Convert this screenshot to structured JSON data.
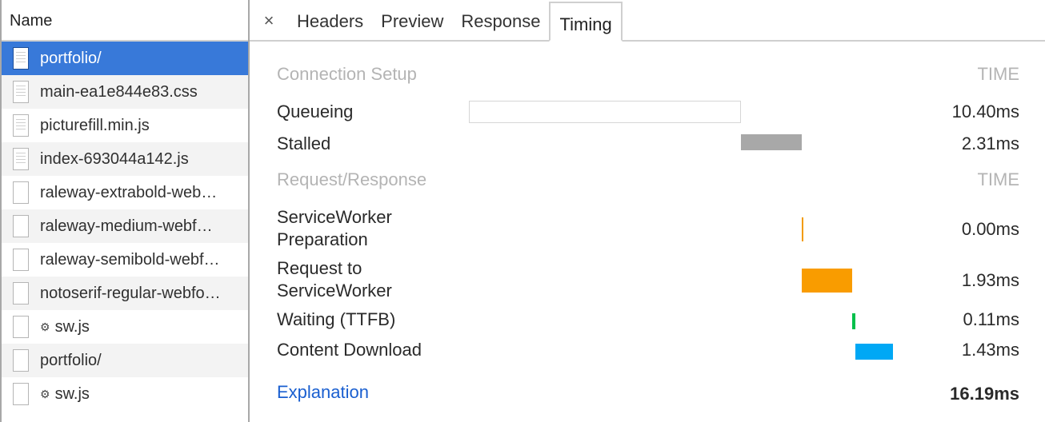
{
  "requests": {
    "header": "Name",
    "items": [
      {
        "name": "portfolio/",
        "icon": "document-icon",
        "gear": false,
        "selected": true
      },
      {
        "name": "main-ea1e844e83.css",
        "icon": "document-icon",
        "gear": false
      },
      {
        "name": "picturefill.min.js",
        "icon": "document-icon",
        "gear": false
      },
      {
        "name": "index-693044a142.js",
        "icon": "document-icon",
        "gear": false
      },
      {
        "name": "raleway-extrabold-web…",
        "icon": "blank-file-icon",
        "gear": false
      },
      {
        "name": "raleway-medium-webf…",
        "icon": "blank-file-icon",
        "gear": false
      },
      {
        "name": "raleway-semibold-webf…",
        "icon": "blank-file-icon",
        "gear": false
      },
      {
        "name": "notoserif-regular-webfo…",
        "icon": "blank-file-icon",
        "gear": false
      },
      {
        "name": "sw.js",
        "icon": "blank-file-icon",
        "gear": true
      },
      {
        "name": "portfolio/",
        "icon": "blank-file-icon",
        "gear": false
      },
      {
        "name": "sw.js",
        "icon": "blank-file-icon",
        "gear": true
      }
    ]
  },
  "tabs": {
    "close_glyph": "×",
    "items": [
      "Headers",
      "Preview",
      "Response",
      "Timing"
    ],
    "active": "Timing"
  },
  "timing": {
    "connection_setup": {
      "title": "Connection Setup",
      "time_label": "TIME",
      "rows": [
        {
          "label": "Queueing",
          "value": "10.40ms",
          "ms": 10.4,
          "color": "#ffffff",
          "outline": true
        },
        {
          "label": "Stalled",
          "value": "2.31ms",
          "ms": 2.31,
          "color": "#a8a8a8"
        }
      ]
    },
    "request_response": {
      "title": "Request/Response",
      "time_label": "TIME",
      "rows": [
        {
          "label": "ServiceWorker\nPreparation",
          "value": "0.00ms",
          "ms": 0.0,
          "color": "#f29b00"
        },
        {
          "label": "Request to\nServiceWorker",
          "value": "1.93ms",
          "ms": 1.93,
          "color": "#f99c00"
        },
        {
          "label": "Waiting (TTFB)",
          "value": "0.11ms",
          "ms": 0.11,
          "color": "#00c04b"
        },
        {
          "label": "Content Download",
          "value": "1.43ms",
          "ms": 1.43,
          "color": "#00a8f5"
        }
      ]
    },
    "explanation_label": "Explanation",
    "total": "16.19ms",
    "total_ms": 16.19
  }
}
